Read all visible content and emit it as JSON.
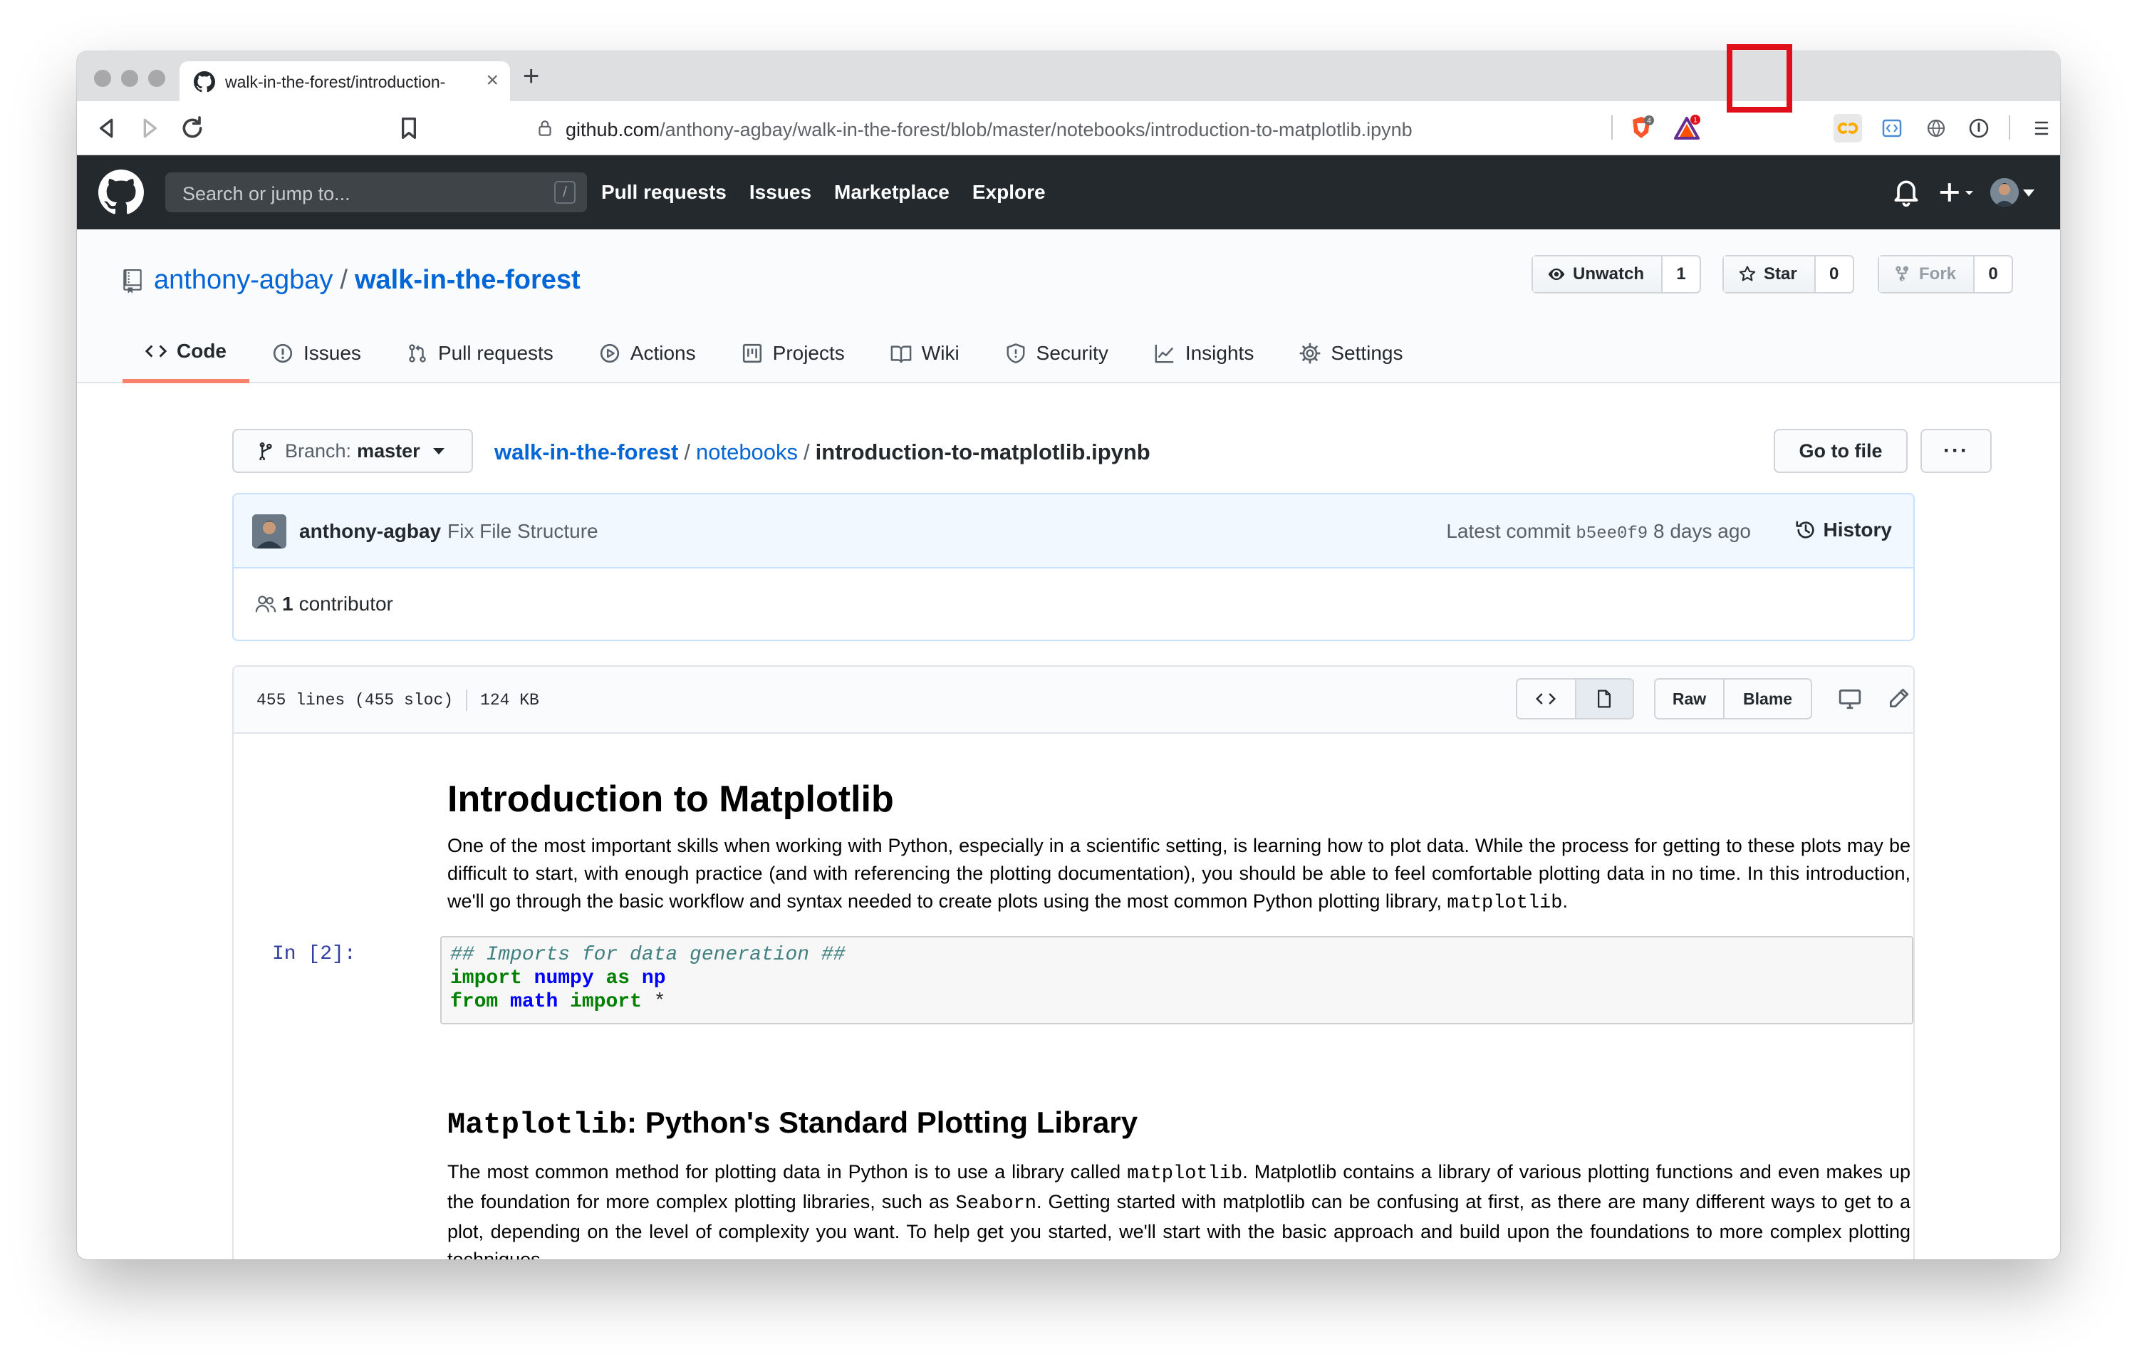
{
  "browser": {
    "tab_title": "walk-in-the-forest/introduction-",
    "url_host": "github.com",
    "url_path": "/anthony-agbay/walk-in-the-forest/blob/master/notebooks/introduction-to-matplotlib.ipynb",
    "brave_badge": "4",
    "rewards_badge": "1",
    "highlight_color": "#e0101a"
  },
  "github": {
    "search_placeholder": "Search or jump to...",
    "search_key": "/",
    "nav": [
      "Pull requests",
      "Issues",
      "Marketplace",
      "Explore"
    ]
  },
  "repo": {
    "owner": "anthony-agbay",
    "name": "walk-in-the-forest",
    "watch_label": "Unwatch",
    "watch_count": "1",
    "star_label": "Star",
    "star_count": "0",
    "fork_label": "Fork",
    "fork_count": "0",
    "tabs": [
      "Code",
      "Issues",
      "Pull requests",
      "Actions",
      "Projects",
      "Wiki",
      "Security",
      "Insights",
      "Settings"
    ]
  },
  "filenav": {
    "branch_label": "Branch:",
    "branch": "master",
    "crumb_repo": "walk-in-the-forest",
    "crumb_dir": "notebooks",
    "crumb_file": "introduction-to-matplotlib.ipynb",
    "go_to_file": "Go to file",
    "more": "···"
  },
  "commit": {
    "author": "anthony-agbay",
    "message": "Fix File Structure",
    "latest_label": "Latest commit",
    "sha": "b5ee0f9",
    "age": "8 days ago",
    "history": "History",
    "contributors_count": "1",
    "contributors_label": "contributor"
  },
  "file": {
    "lines": "455 lines (455 sloc)",
    "size": "124 KB",
    "raw": "Raw",
    "blame": "Blame"
  },
  "notebook": {
    "h1": "Introduction to Matplotlib",
    "p1": "One of the most important skills when working with Python, especially in a scientific setting, is learning how to plot data. While the process for getting to these plots may be difficult to start, with enough practice (and with referencing the plotting documentation), you should be able to feel comfortable plotting data in no time. In this introduction, we'll go through the basic workflow and syntax needed to create plots using the most common Python plotting library, ",
    "p1_code": "matplotlib",
    "p1_end": ".",
    "prompt": "In [2]:",
    "code_comment": "## Imports for data generation ##",
    "code_l2_kw1": "import",
    "code_l2_mod": "numpy",
    "code_l2_kw2": "as",
    "code_l2_alias": "np",
    "code_l3_kw1": "from",
    "code_l3_mod": "math",
    "code_l3_kw2": "import",
    "code_l3_star": "*",
    "h2_code": "Matplotlib",
    "h2_text": ": Python's Standard Plotting Library",
    "p2_a": "The most common method for plotting data in Python is to use a library called ",
    "p2_code1": "matplotlib",
    "p2_b": ". Matplotlib contains a library of various plotting functions and even makes up the foundation for more complex plotting libraries, such as ",
    "p2_code2": "Seaborn",
    "p2_c": ". Getting started with matplotlib can be confusing at first, as there are many different ways to get to a plot, depending on the level of complexity you want. To help get you started, we'll start with the basic approach and build upon the foundations to more complex plotting techniques."
  }
}
